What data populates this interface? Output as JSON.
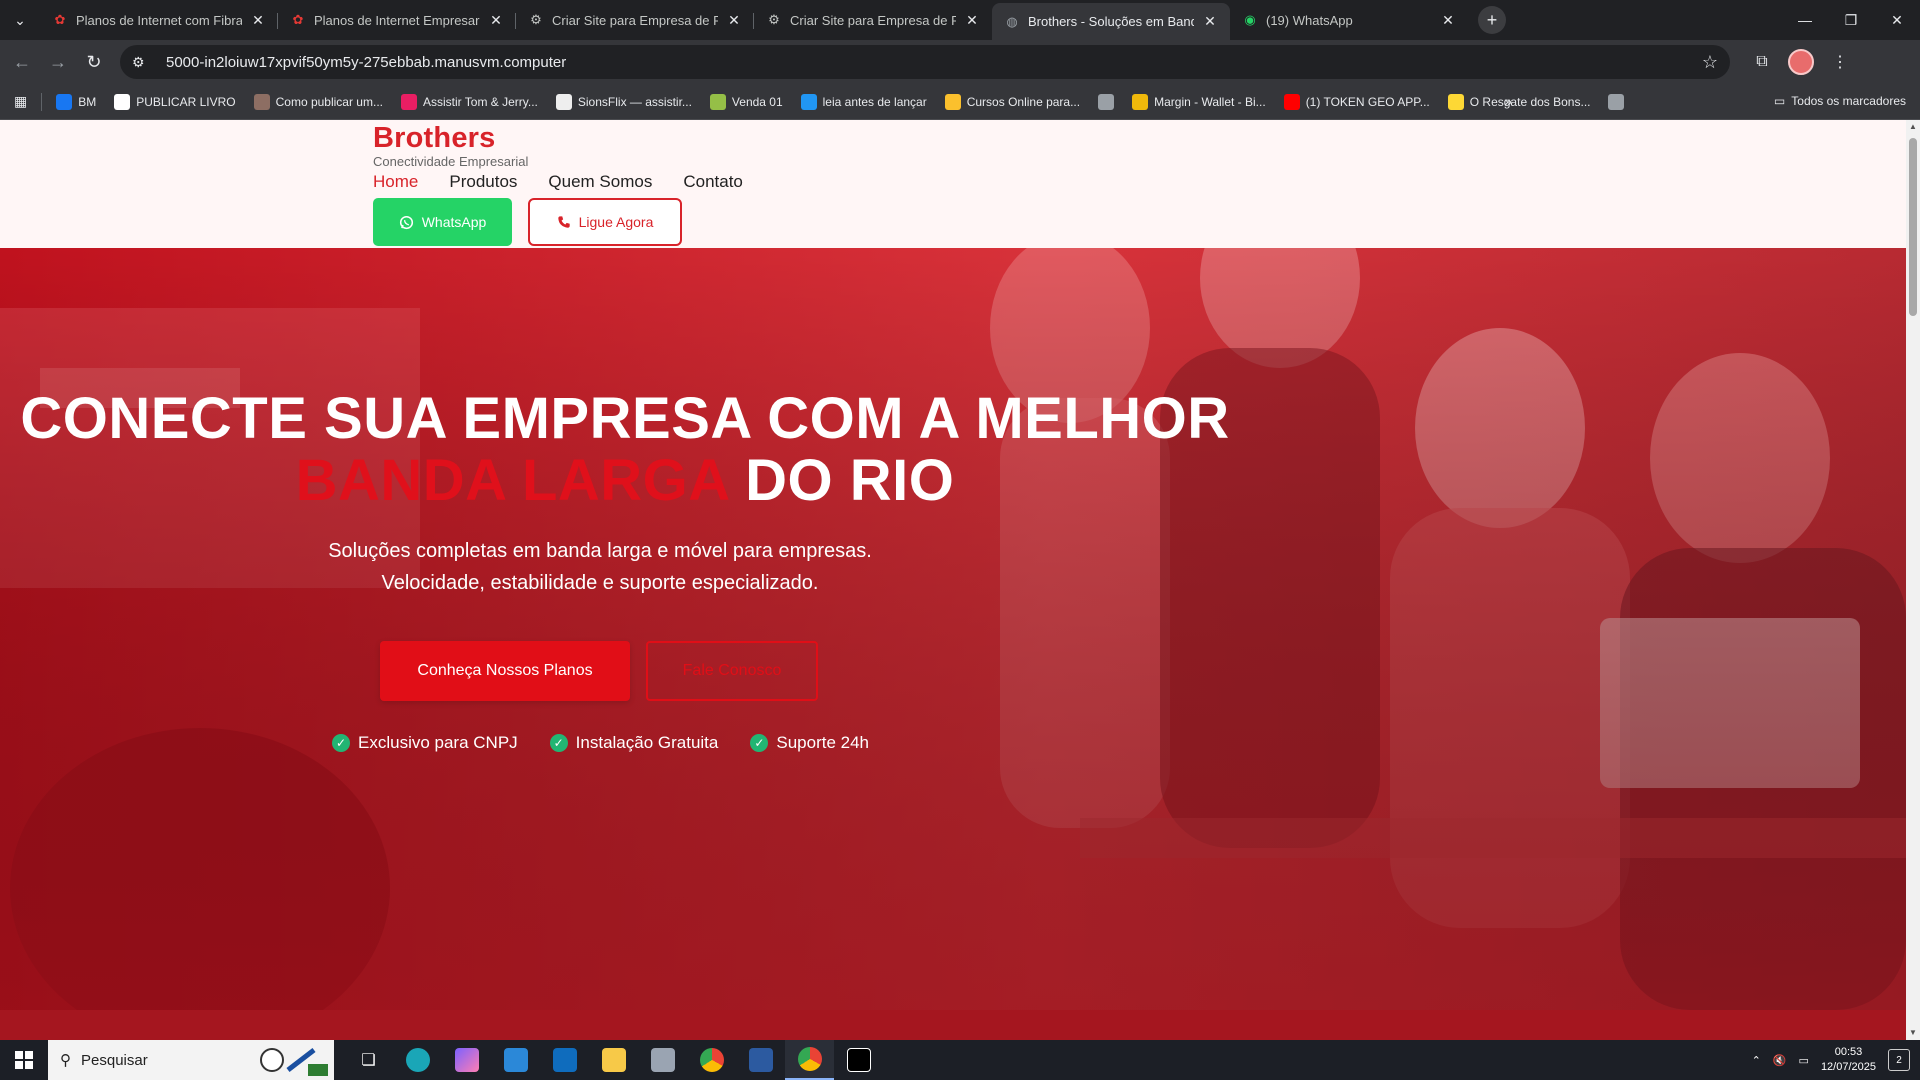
{
  "tabs": [
    {
      "title": "Planos de Internet com Fibra, Te",
      "active": false
    },
    {
      "title": "Planos de Internet Empresarial",
      "active": false
    },
    {
      "title": "Criar Site para Empresa de Prod",
      "active": false
    },
    {
      "title": "Criar Site para Empresa de Prod",
      "active": false
    },
    {
      "title": "Brothers - Soluções em Banda L",
      "active": true
    },
    {
      "title": "(19) WhatsApp",
      "active": false
    }
  ],
  "address_bar": {
    "url": "5000-in2loiuw17xpvif50ym5y-275ebbab.manusvm.computer"
  },
  "bookmarks": [
    {
      "label": "BM",
      "icon": "meta-icon",
      "color": "#1877f2"
    },
    {
      "label": "PUBLICAR LIVRO",
      "icon": "amazon-icon",
      "color": "#ffffff"
    },
    {
      "label": "Como publicar um...",
      "icon": "folder-icon",
      "color": "#8d6e63"
    },
    {
      "label": "Assistir Tom & Jerry...",
      "icon": "video-icon",
      "color": "#e91e63"
    },
    {
      "label": "SionsFlix — assistir...",
      "icon": "flix-icon",
      "color": "#eeeeee"
    },
    {
      "label": "Venda 01",
      "icon": "shopify-icon",
      "color": "#95bf47"
    },
    {
      "label": "leia antes de lançar",
      "icon": "flag-icon",
      "color": "#2196f3"
    },
    {
      "label": "Cursos Online para...",
      "icon": "hotmart-icon",
      "color": "#fbc02d"
    },
    {
      "label": "",
      "icon": "globe-icon",
      "color": "#9aa0a6"
    },
    {
      "label": "Margin - Wallet - Bi...",
      "icon": "binance-icon",
      "color": "#f0b90b"
    },
    {
      "label": "(1) TOKEN GEO APP...",
      "icon": "youtube-icon",
      "color": "#ff0000"
    },
    {
      "label": "O Resgate dos Bons...",
      "icon": "g-icon",
      "color": "#fdd835"
    },
    {
      "label": "",
      "icon": "globe-icon",
      "color": "#9aa0a6"
    }
  ],
  "bookmarks_all": "Todos os marcadores",
  "site": {
    "brand": "Brothers",
    "tagline": "Conectividade Empresarial",
    "nav": [
      "Home",
      "Produtos",
      "Quem Somos",
      "Contato"
    ],
    "whatsapp_button": "WhatsApp",
    "call_button": "Ligue Agora",
    "hero": {
      "title_line1": "CONECTE SUA EMPRESA COM A MELHOR",
      "title_highlight": "BANDA LARGA",
      "title_line2_rest": "DO RIO",
      "subtitle_line1": "Soluções completas em banda larga e móvel para empresas.",
      "subtitle_line2": "Velocidade, estabilidade e suporte especializado.",
      "primary_cta": "Conheça Nossos Planos",
      "secondary_cta": "Fale Conosco",
      "features": [
        "Exclusivo para CNPJ",
        "Instalação Gratuita",
        "Suporte 24h"
      ]
    }
  },
  "taskbar": {
    "search_placeholder": "Pesquisar",
    "time": "00:53",
    "date": "12/07/2025",
    "notifications": "2"
  },
  "colors": {
    "brand_red": "#d8232a",
    "cta_red": "#e10e17",
    "whatsapp_green": "#25d366",
    "check_green": "#22b573"
  }
}
